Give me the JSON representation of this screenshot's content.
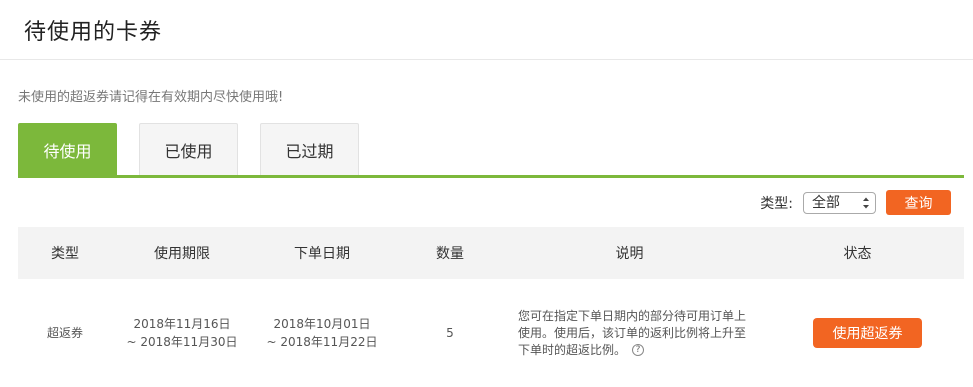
{
  "page": {
    "title": "待使用的卡券",
    "notice": "未使用的超返券请记得在有效期内尽快使用哦!"
  },
  "tabs": [
    {
      "label": "待使用",
      "active": true
    },
    {
      "label": "已使用",
      "active": false
    },
    {
      "label": "已过期",
      "active": false
    }
  ],
  "filter": {
    "label": "类型:",
    "selected": "全部",
    "search_label": "查询"
  },
  "table": {
    "headers": [
      "类型",
      "使用期限",
      "下单日期",
      "数量",
      "说明",
      "状态"
    ],
    "rows": [
      {
        "type": "超返券",
        "period_start": "2018年11月16日",
        "period_end": "~ 2018年11月30日",
        "order_start": "2018年10月01日",
        "order_end": "~ 2018年11月22日",
        "quantity": "5",
        "description": "您可在指定下单日期内的部分待可用订单上使用。使用后，该订单的返利比例将上升至下单时的超返比例。",
        "help_icon": "?",
        "action_label": "使用超返券"
      }
    ]
  },
  "colors": {
    "accent_green": "#7cb83b",
    "accent_orange": "#f26522"
  }
}
